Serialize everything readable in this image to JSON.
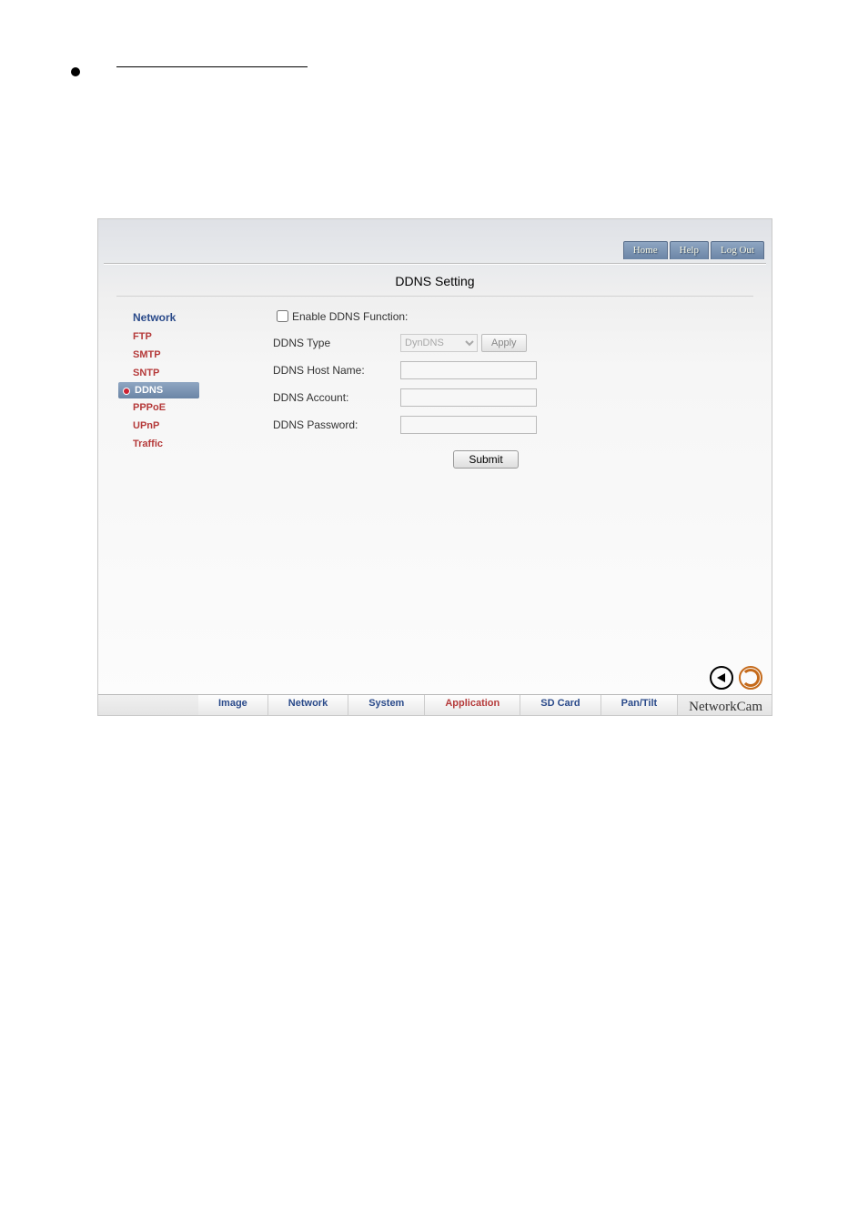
{
  "top_links": {
    "home": "Home",
    "help": "Help",
    "logout": "Log Out"
  },
  "page_title": "DDNS Setting",
  "sidebar": {
    "head": "Network",
    "items": [
      "FTP",
      "SMTP",
      "SNTP",
      "DDNS",
      "PPPoE",
      "UPnP",
      "Traffic"
    ],
    "active_index": 3
  },
  "form": {
    "enable_label": "Enable DDNS Function:",
    "type_label": "DDNS Type",
    "type_value": "DynDNS",
    "apply_label": "Apply",
    "host_label": "DDNS Host Name:",
    "host_value": "",
    "account_label": "DDNS Account:",
    "account_value": "",
    "password_label": "DDNS Password:",
    "password_value": "",
    "submit_label": "Submit"
  },
  "tabs": {
    "image": "Image",
    "network": "Network",
    "system": "System",
    "application": "Application",
    "sdcard": "SD Card",
    "pantilt": "Pan/Tilt"
  },
  "brand": "NetworkCam",
  "icons": {
    "back": "back-icon",
    "refresh": "refresh-icon"
  }
}
